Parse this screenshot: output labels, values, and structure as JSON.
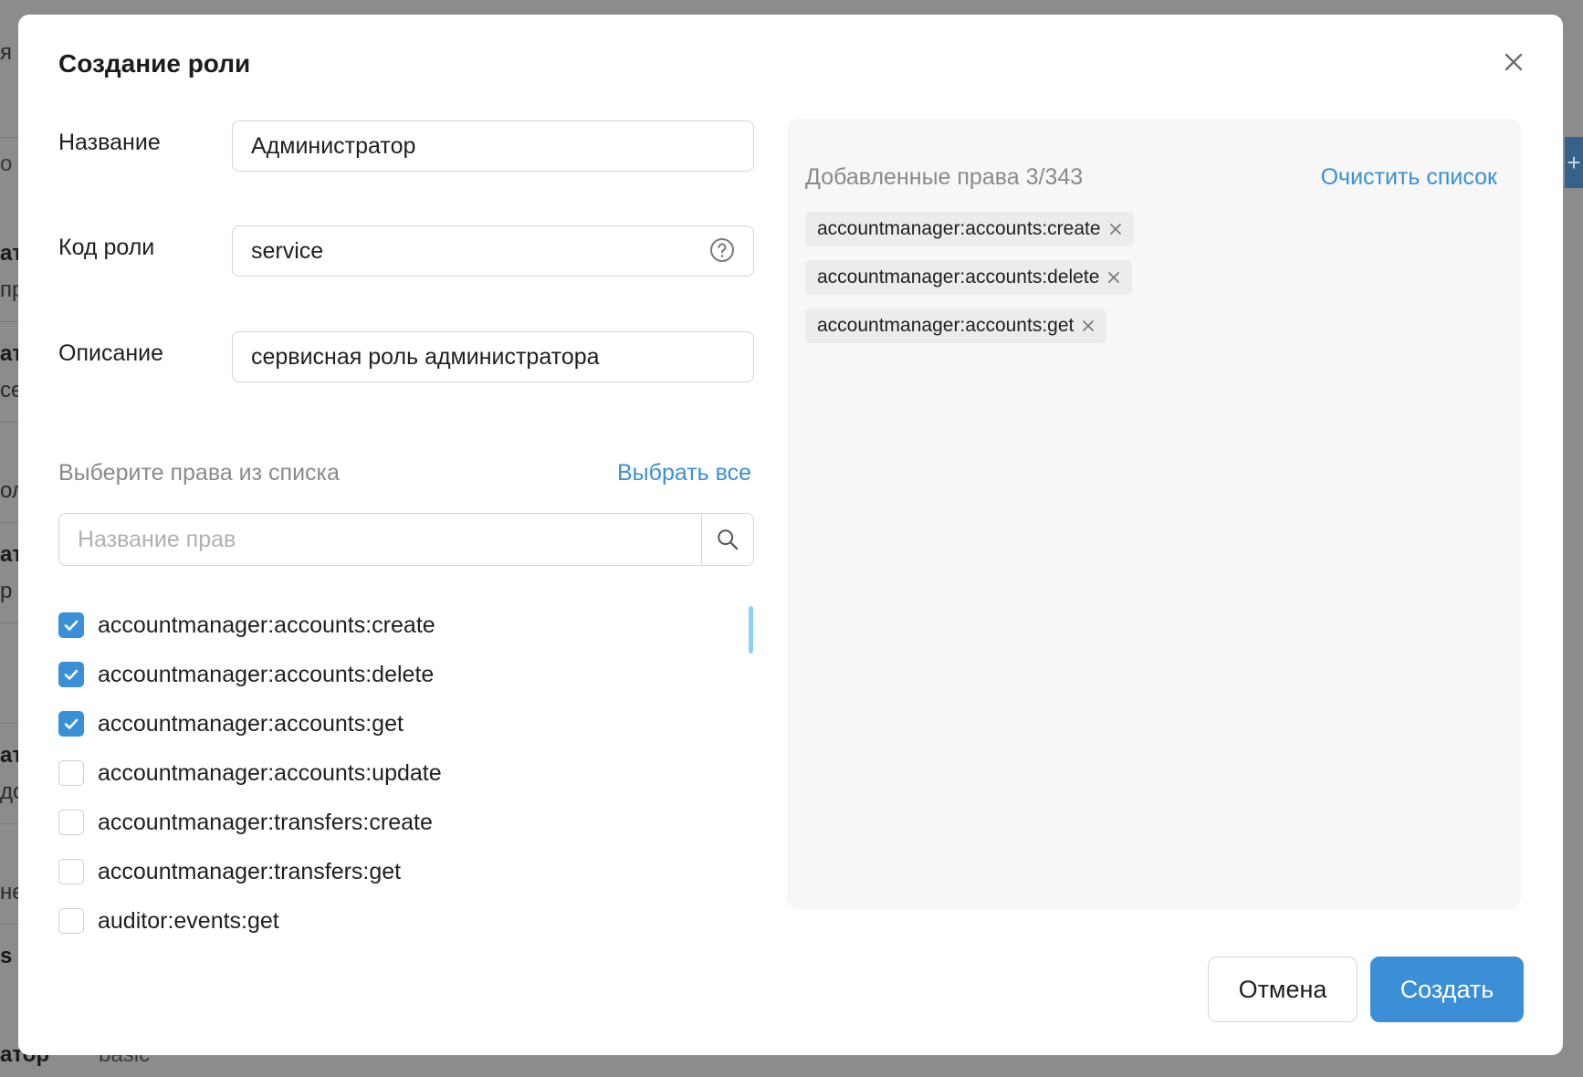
{
  "background": {
    "fragments": [
      "я",
      "о",
      "ат",
      "пр",
      "ат",
      "се",
      "ол",
      "ат",
      "р",
      "ат",
      "до",
      "не",
      "s",
      "атор",
      "basic"
    ]
  },
  "modal": {
    "title": "Создание роли",
    "fields": {
      "name": {
        "label": "Название",
        "value": "Администратор"
      },
      "role_code": {
        "label": "Код роли",
        "value": "service"
      },
      "description": {
        "label": "Описание",
        "value": "сервисная роль администратора"
      }
    },
    "permissions": {
      "caption": "Выберите права из списка",
      "select_all_label": "Выбрать все",
      "search_placeholder": "Название прав",
      "items": [
        {
          "label": "accountmanager:accounts:create",
          "checked": true
        },
        {
          "label": "accountmanager:accounts:delete",
          "checked": true
        },
        {
          "label": "accountmanager:accounts:get",
          "checked": true
        },
        {
          "label": "accountmanager:accounts:update",
          "checked": false
        },
        {
          "label": "accountmanager:transfers:create",
          "checked": false
        },
        {
          "label": "accountmanager:transfers:get",
          "checked": false
        },
        {
          "label": "auditor:events:get",
          "checked": false
        }
      ]
    },
    "added": {
      "caption": "Добавленные права 3/343",
      "clear_label": "Очистить список",
      "chips": [
        "accountmanager:accounts:create",
        "accountmanager:accounts:delete",
        "accountmanager:accounts:get"
      ]
    },
    "buttons": {
      "cancel_label": "Отмена",
      "create_label": "Создать"
    }
  },
  "colors": {
    "accent": "#3b8fd6",
    "overlay": "#8c8c8c",
    "panel": "#f7f7f7"
  }
}
